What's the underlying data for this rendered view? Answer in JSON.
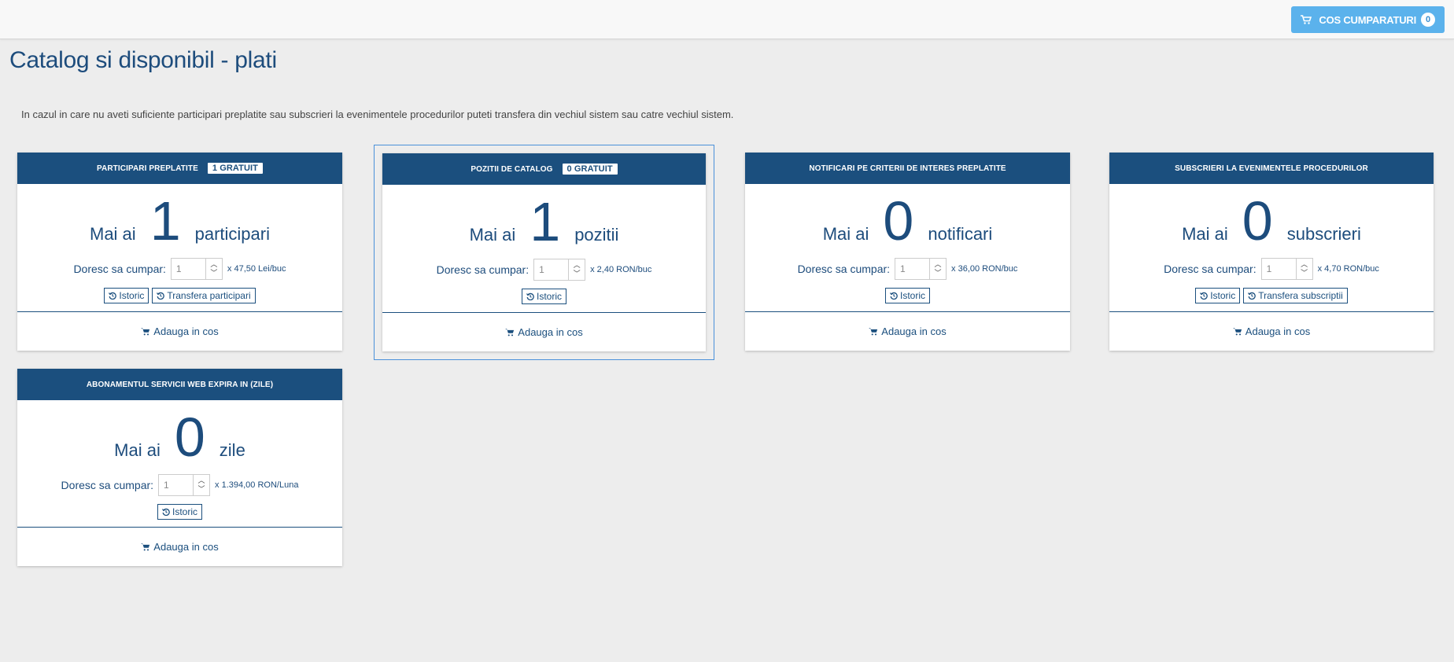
{
  "header": {
    "cart_button_label": "COS CUMPARATURI",
    "cart_count": "0"
  },
  "page": {
    "title": "Catalog si disponibil - plati",
    "info": "In cazul in care nu aveti suficiente participari preplatite sau subscrieri la evenimentele procedurilor puteti transfera din vechiul sistem sau catre vechiul sistem."
  },
  "common": {
    "mai_ai": "Mai ai",
    "doresc": "Doresc sa cumpar:",
    "istoric": "Istoric",
    "add_to_cart": "Adauga in cos"
  },
  "cards": [
    {
      "title": "PARTICIPARI PREPLATITE",
      "badge": "1 GRATUIT",
      "count": "1",
      "unit": "participari",
      "qty": "1",
      "price": "x 47,50 Lei/buc",
      "transfer": "Transfera participari"
    },
    {
      "title": "POZITII DE CATALOG",
      "badge": "0 GRATUIT",
      "count": "1",
      "unit": "pozitii",
      "qty": "1",
      "price": "x 2,40 RON/buc"
    },
    {
      "title": "NOTIFICARI PE CRITERII DE INTERES PREPLATITE",
      "count": "0",
      "unit": "notificari",
      "qty": "1",
      "price": "x 36,00 RON/buc"
    },
    {
      "title": "SUBSCRIERI LA EVENIMENTELE PROCEDURILOR",
      "count": "0",
      "unit": "subscrieri",
      "qty": "1",
      "price": "x 4,70 RON/buc",
      "transfer": "Transfera subscriptii"
    },
    {
      "title": "ABONAMENTUL SERVICII WEB EXPIRA IN (ZILE)",
      "count": "0",
      "unit": "zile",
      "qty": "1",
      "price": "x 1.394,00 RON/Luna"
    }
  ],
  "icons": {
    "cart": "shopping-cart-icon",
    "history": "history-icon",
    "spinner_up": "chevron-up-icon",
    "spinner_down": "chevron-down-icon"
  },
  "colors": {
    "primary": "#1b4f7e",
    "cart_button": "#5bb2ec",
    "background": "#ededed"
  }
}
